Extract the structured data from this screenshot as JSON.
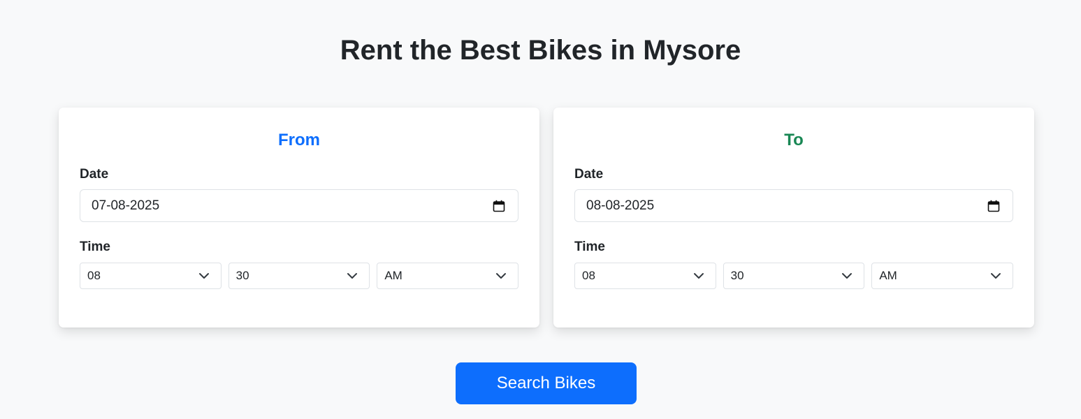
{
  "page": {
    "title": "Rent the Best Bikes in Mysore"
  },
  "from": {
    "heading": "From",
    "date_label": "Date",
    "date_value": "07-08-2025",
    "time_label": "Time",
    "hour": "08",
    "minute": "30",
    "period": "AM",
    "accent_color": "#0d6efd"
  },
  "to": {
    "heading": "To",
    "date_label": "Date",
    "date_value": "08-08-2025",
    "time_label": "Time",
    "hour": "08",
    "minute": "30",
    "period": "AM",
    "accent_color": "#198754"
  },
  "actions": {
    "search_label": "Search Bikes",
    "button_color": "#0d6efd"
  },
  "icons": {
    "date_picker": "calendar-icon",
    "select": "chevron-down-icon"
  }
}
